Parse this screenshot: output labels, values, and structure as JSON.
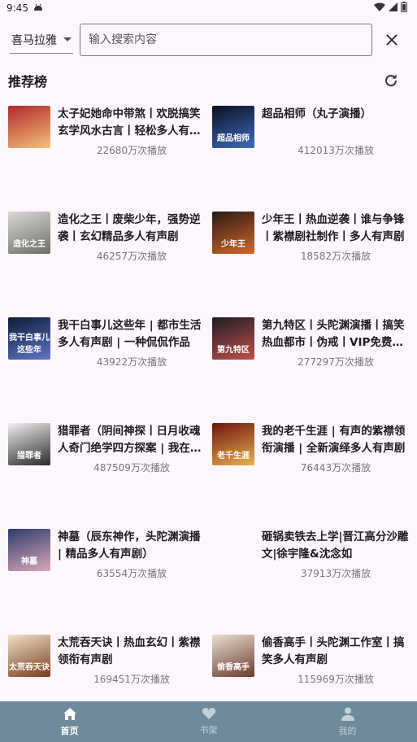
{
  "status": {
    "time": "9:45"
  },
  "search": {
    "source": "喜马拉雅",
    "placeholder": "输入搜索内容"
  },
  "section": {
    "title": "推荐榜"
  },
  "books": [
    {
      "title": "太子妃她命中带煞丨欢脱搞笑玄学风水古言丨轻松多人有声剧",
      "plays": "22680万次播放",
      "cover_text": "",
      "colors": [
        "#b0282d",
        "#f3c27a"
      ]
    },
    {
      "title": "超品相师（丸子演播）",
      "plays": "412013万次播放",
      "cover_text": "超品相师",
      "colors": [
        "#0e1020",
        "#3b6cbf"
      ]
    },
    {
      "title": "造化之王丨废柴少年，强势逆袭丨玄幻精品多人有声剧",
      "plays": "46257万次播放",
      "cover_text": "造化之王",
      "colors": [
        "#d9d9d4",
        "#6d6d6a"
      ]
    },
    {
      "title": "少年王丨热血逆袭丨谁与争锋丨紫襟剧社制作丨多人有声剧",
      "plays": "18582万次播放",
      "cover_text": "少年王",
      "colors": [
        "#2a1a14",
        "#d4662a"
      ]
    },
    {
      "title": "我干白事儿这些年 | 都市生活多人有声剧 | 一种侃侃作品",
      "plays": "43922万次播放",
      "cover_text": "我干白事儿这些年",
      "colors": [
        "#0d1a3a",
        "#5f77c4"
      ]
    },
    {
      "title": "第九特区丨头陀渊演播丨搞笑热血都市丨伪戒丨VIP免费收听",
      "plays": "277297万次播放",
      "cover_text": "第九特区",
      "colors": [
        "#1d1d26",
        "#c0504a"
      ]
    },
    {
      "title": "猎罪者（阴间神探丨日月收魂人奇门绝学四方探案 | 我在阴间当神探）",
      "plays": "487509万次播放",
      "cover_text": "猎罪者",
      "colors": [
        "#f0f0ee",
        "#2a2a2a"
      ]
    },
    {
      "title": "我的老千生涯 | 有声的紫襟领衔演播 | 全新演绎多人有声剧",
      "plays": "76443万次播放",
      "cover_text": "老千生涯",
      "colors": [
        "#6e1410",
        "#e8b04c"
      ]
    },
    {
      "title": "神墓（辰东神作，头陀渊演播 | 精品多人有声剧）",
      "plays": "63554万次播放",
      "cover_text": "神墓",
      "colors": [
        "#2c3b6b",
        "#d9a9b8"
      ]
    },
    {
      "title": "砸锅卖铁去上学|晋江高分沙雕文|徐宇隆&沈念如",
      "plays": "37913万次播放",
      "cover_text": "",
      "colors": [
        "#fdf6fd",
        "#fdf6fd"
      ]
    },
    {
      "title": "太荒吞天诀丨热血玄幻丨紫襟领衔有声剧",
      "plays": "169451万次播放",
      "cover_text": "太荒吞天诀",
      "colors": [
        "#eee3c8",
        "#7a3b1e"
      ]
    },
    {
      "title": "偷香高手丨头陀渊工作室丨搞笑多人有声剧",
      "plays": "115969万次播放",
      "cover_text": "偷香高手",
      "colors": [
        "#e9dfd2",
        "#6b3b2c"
      ]
    }
  ],
  "nav": [
    {
      "label": "首页",
      "icon": "home-icon",
      "active": true
    },
    {
      "label": "书架",
      "icon": "heart-icon",
      "active": false
    },
    {
      "label": "我的",
      "icon": "person-icon",
      "active": false
    }
  ]
}
